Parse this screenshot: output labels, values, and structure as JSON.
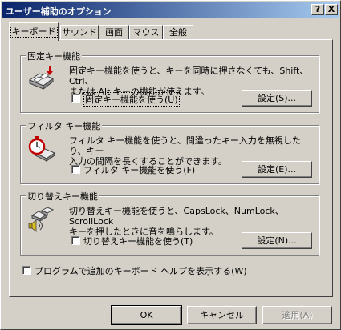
{
  "window": {
    "title": "ユーザー補助のオプション",
    "help_glyph": "?",
    "close_glyph": "X"
  },
  "tabs": [
    {
      "label": "キーボード",
      "active": true
    },
    {
      "label": "サウンド",
      "active": false
    },
    {
      "label": "画面",
      "active": false
    },
    {
      "label": "マウス",
      "active": false
    },
    {
      "label": "全般",
      "active": false
    }
  ],
  "sticky": {
    "title": "固定キー機能",
    "desc_line1": "固定キー機能を使うと、キーを同時に押さなくても、Shift、Ctrl、",
    "desc_line2": "または Alt キーの機能が使えます。",
    "checkbox": "固定キー機能を使う(U)",
    "checked": false,
    "settings": "設定(S)...",
    "icon": "keyboard-sticky-keys-icon"
  },
  "filter": {
    "title": "フィルタ キー機能",
    "desc_line1": "フィルタ キー機能を使うと、間違ったキー入力を無視したり、キー",
    "desc_line2": "入力の間隔を長くすることができます。",
    "checkbox": "フィルタ キー機能を使う(F)",
    "checked": false,
    "settings": "設定(E)...",
    "icon": "stopwatch-key-icon"
  },
  "toggle": {
    "title": "切り替えキー機能",
    "desc_line1": "切り替えキー機能を使うと、CapsLock、NumLock、ScrollLock",
    "desc_line2": "キーを押したときに音を鳴らします。",
    "checkbox": "切り替えキー機能を使う(T)",
    "checked": false,
    "settings": "設定(N)...",
    "icon": "speaker-keys-icon"
  },
  "extra_help": {
    "checkbox": "プログラムで追加のキーボード ヘルプを表示する(W)",
    "checked": false
  },
  "buttons": {
    "ok": "OK",
    "cancel": "キャンセル",
    "apply": "適用(A)"
  }
}
